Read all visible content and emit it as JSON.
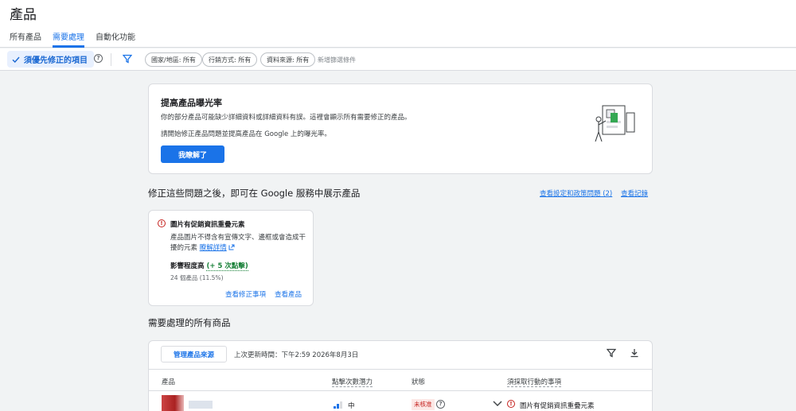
{
  "header": {
    "title": "產品"
  },
  "tabs": [
    {
      "label": "所有產品",
      "active": false
    },
    {
      "label": "需要處理",
      "active": true
    },
    {
      "label": "自動化功能",
      "active": false
    }
  ],
  "filters": {
    "primary_chip": "須優先修正的項目",
    "chips": [
      "國家/地區: 所有",
      "行銷方式: 所有",
      "資料來源: 所有"
    ],
    "add_filter": "新增篩選條件"
  },
  "promo": {
    "title": "提高產品曝光率",
    "text1": "你的部分產品可能缺少詳細資料或詳細資料有誤。這裡會顯示所有需要修正的產品。",
    "text2": "請開始修正產品問題並提高產品在 Google 上的曝光率。",
    "button": "我瞭解了"
  },
  "issues_section": {
    "title": "修正這些問題之後，即可在 Google 服務中展示產品",
    "link_policy": "查看設定和政策問題 (2)",
    "link_history": "查看記錄"
  },
  "issue_card": {
    "title": "圖片有促銷資訊重疊元素",
    "desc": "產品圖片不得含有宣傳文字、邊框或會造成干擾的元素",
    "learn_more": "瞭解詳情",
    "impact_label": "影響程度高",
    "impact_value": "(+ 5 次點擊)",
    "impact_sub": "24 個產品 (11.5%)",
    "link_fix": "查看修正事項",
    "link_products": "查看產品"
  },
  "products_section": {
    "title": "需要處理的所有商品",
    "manage_button": "管理產品來源",
    "updated": "上次更新時間：下午2:59 2026年8月3日",
    "columns": [
      "產品",
      "點擊次數潛力",
      "狀態",
      "須採取行動的事項"
    ],
    "rows": [
      {
        "clicks": "中",
        "status": "未核准",
        "action": "圖片有促銷資訊重疊元素"
      }
    ]
  },
  "colors": {
    "accent": "#1a73e8",
    "error": "#c5221f",
    "success": "#188038"
  }
}
